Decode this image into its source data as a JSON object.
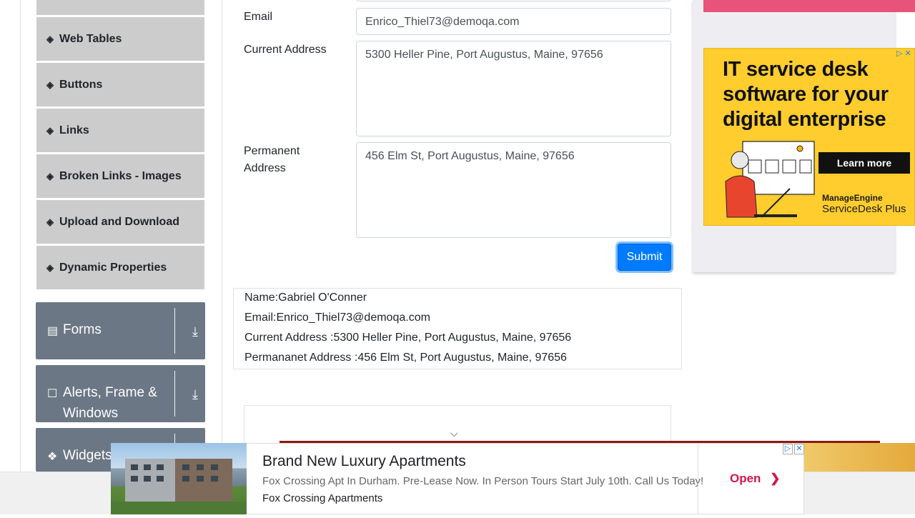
{
  "sidebar": {
    "items": [
      {
        "label": "Web Tables",
        "icon": "html5-icon"
      },
      {
        "label": "Buttons",
        "icon": "html5-icon"
      },
      {
        "label": "Links",
        "icon": "html5-icon"
      },
      {
        "label": "Broken Links - Images",
        "icon": "html5-icon"
      },
      {
        "label": "Upload and Download",
        "icon": "html5-icon"
      },
      {
        "label": "Dynamic Properties",
        "icon": "html5-icon"
      }
    ],
    "groups": [
      {
        "label": "Forms",
        "icon": "list-icon"
      },
      {
        "label": "Alerts, Frame & Windows",
        "icon": "window-icon"
      },
      {
        "label": "Widgets",
        "icon": "widgets-icon"
      }
    ]
  },
  "form": {
    "email_label": "Email",
    "email_value": "Enrico_Thiel73@demoqa.com",
    "current_address_label": "Current Address",
    "current_address_value": "5300 Heller Pine, Port Augustus, Maine, 97656",
    "permanent_address_label": "Permanent Address",
    "permanent_address_value": "456 Elm St, Port Augustus, Maine, 97656",
    "submit_label": "Submit"
  },
  "output": {
    "name": "Name:Gabriel O'Conner",
    "email": "Email:Enrico_Thiel73@demoqa.com",
    "current_address": "Current Address :5300 Heller Pine, Port Augustus, Maine, 97656",
    "permanent_address": "Permananet Address :456 Elm St, Port Augustus, Maine, 97656"
  },
  "right_ad": {
    "headline": "IT service desk software for your digital enterprise",
    "cta": "Learn more",
    "brand": "ManageEngine",
    "product": "ServiceDesk Plus"
  },
  "bottom_ad": {
    "title": "Brand New Luxury Apartments",
    "description": "Fox Crossing Apt In Durham. Pre-Lease Now. In Person Tours Start July 10th. Call Us Today!",
    "advertiser": "Fox Crossing Apartments",
    "cta": "Open"
  },
  "colors": {
    "primary": "#007bff",
    "sidebar_item_bg": "#cccccc",
    "group_bg": "#6b7785",
    "ad_yellow": "#ffcd2e",
    "ad_open": "#d0174c"
  }
}
